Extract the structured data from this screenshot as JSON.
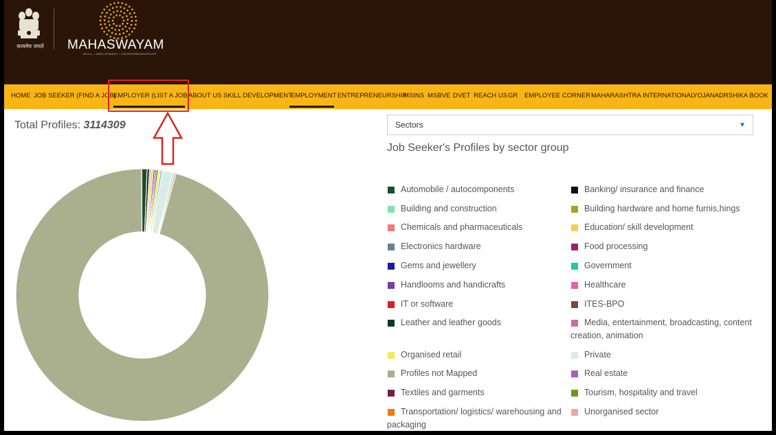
{
  "header": {
    "emblem_caption": "सत्यमेव जयते",
    "brand_name": "MAHASWAYAM",
    "brand_tagline": "SKILL • EMPLOYMENT • ENTREPRENEURSHIP"
  },
  "nav": {
    "items": [
      {
        "label": "HOME"
      },
      {
        "label": "JOB SEEKER (FIND A JOB)"
      },
      {
        "label": "EMPLOYER (LIST A JOB)"
      },
      {
        "label": "ABOUT US"
      },
      {
        "label": "SKILL DEVELOPMENT"
      },
      {
        "label": "EMPLOYMENT"
      },
      {
        "label": "ENTREPRENEURSHIP"
      },
      {
        "label": "MSINS"
      },
      {
        "label": "MSBVE"
      },
      {
        "label": "DVET"
      },
      {
        "label": "REACH US"
      },
      {
        "label": "GR"
      },
      {
        "label": "EMPLOYEE CORNER"
      },
      {
        "label": "MAHARASHTRA INTERNATIONAL"
      },
      {
        "label": "YOJANADRSHIKA BOOK"
      }
    ],
    "active": "EMPLOYMENT",
    "highlighted": "EMPLOYER (LIST A JOB)"
  },
  "summary": {
    "total_label": "Total Profiles:",
    "total_value": "3114309"
  },
  "filter": {
    "selected": "Sectors"
  },
  "chart_title": "Job Seeker's Profiles by sector group",
  "chart_data": {
    "type": "pie",
    "style": "donut",
    "hole_ratio": 0.5,
    "slices": [
      {
        "label": "Profiles not Mapped",
        "value": 95.8,
        "color": "#aab08e"
      },
      {
        "label": "Automobile / autocomponents",
        "value": 0.7,
        "color": "#1e4d2b"
      },
      {
        "label": "Banking/ insurance and finance",
        "value": 0.3,
        "color": "#111111"
      },
      {
        "label": "Building hardware and home furnis,hings",
        "value": 0.2,
        "color": "#a9a02a"
      },
      {
        "label": "Education/ skill development",
        "value": 0.3,
        "color": "#eecf5a"
      },
      {
        "label": "Gems and jewellery",
        "value": 0.2,
        "color": "#1a1aa0"
      },
      {
        "label": "IT or software",
        "value": 0.2,
        "color": "#e01e1e"
      },
      {
        "label": "Leather and leather goods",
        "value": 0.2,
        "color": "#0c3b23"
      },
      {
        "label": "Organised retail",
        "value": 0.3,
        "color": "#eeec5c"
      },
      {
        "label": "Electronics hardware",
        "value": 0.2,
        "color": "#5f8595"
      },
      {
        "label": "Private",
        "value": 1.4,
        "color": "#d9ede6"
      },
      {
        "label": "Building and construction",
        "value": 0.2,
        "color": "#7fe2b0"
      },
      {
        "label": "Chemicals and pharmaceuticals",
        "value": 0.2,
        "color": "#ee7b7e"
      }
    ]
  },
  "legend": [
    {
      "label": "Automobile / autocomponents",
      "color": "#1e4d2b"
    },
    {
      "label": "Banking/ insurance and finance",
      "color": "#111111"
    },
    {
      "label": "Building and construction",
      "color": "#7fe2b0"
    },
    {
      "label": "Building hardware and home furnis,hings",
      "color": "#a9a02a"
    },
    {
      "label": "Chemicals and pharmaceuticals",
      "color": "#ee7b7e"
    },
    {
      "label": "Education/ skill development",
      "color": "#eecf5a"
    },
    {
      "label": "Electronics hardware",
      "color": "#5f8595"
    },
    {
      "label": "Food processing",
      "color": "#a01e6a"
    },
    {
      "label": "Gems and jewellery",
      "color": "#1a1aa0"
    },
    {
      "label": "Government",
      "color": "#22c7a5"
    },
    {
      "label": "Handlooms and handicrafts",
      "color": "#7a3aa8"
    },
    {
      "label": "Healthcare",
      "color": "#e462a8"
    },
    {
      "label": "IT or software",
      "color": "#e01e1e"
    },
    {
      "label": "ITES-BPO",
      "color": "#7b4a33"
    },
    {
      "label": "Leather and leather goods",
      "color": "#0c3b23"
    },
    {
      "label": "Media, entertainment, broadcasting, content creation, animation",
      "color": "#cc6f9a"
    },
    {
      "label": "Organised retail",
      "color": "#eeec5c"
    },
    {
      "label": "Private",
      "color": "#d9ede6"
    },
    {
      "label": "Profiles not Mapped",
      "color": "#aab08e"
    },
    {
      "label": "Real estate",
      "color": "#a262c4"
    },
    {
      "label": "Textiles and garments",
      "color": "#7a1f47"
    },
    {
      "label": "Tourism, hospitality and travel",
      "color": "#6a9a10"
    },
    {
      "label": "Transportation/ logistics/ warehousing and packaging",
      "color": "#f07a0a"
    },
    {
      "label": "Unorganised sector",
      "color": "#f4a3a3"
    }
  ]
}
